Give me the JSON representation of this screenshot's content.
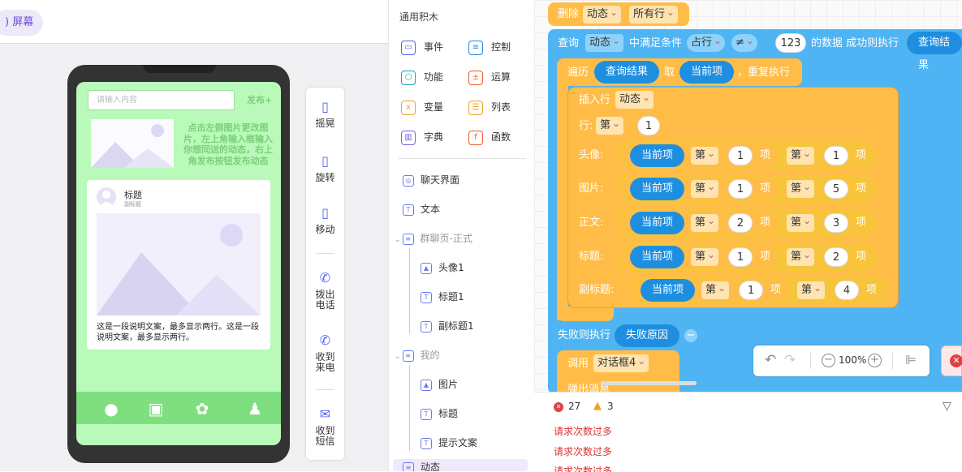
{
  "topbar": {
    "screen_label": ") 屏幕"
  },
  "phone": {
    "search_placeholder": "请输入内容",
    "post_label": "发布+",
    "tip_text": "点击左侧图片更改图片，左上角输入框输入你想同送的动态，右上角发布按钮发布动态",
    "card_title": "标题",
    "card_subtitle": "副标题",
    "card_desc": "这是一段说明文案，最多显示两行。这是一段说明文案，最多显示两行。",
    "tabs": [
      "wechat-icon",
      "contacts-icon",
      "discover-icon",
      "me-icon"
    ]
  },
  "tools": [
    {
      "label": "摇晃",
      "icon": "phone-shake-icon"
    },
    {
      "label": "旋转",
      "icon": "rotate-icon"
    },
    {
      "label": "移动",
      "icon": "move-icon"
    },
    {
      "label": "拨出\n电话",
      "icon": "call-out-icon"
    },
    {
      "label": "收到\n来电",
      "icon": "call-in-icon"
    },
    {
      "label": "收到\n短信",
      "icon": "sms-icon"
    }
  ],
  "blocks_panel": {
    "header": "通用积木",
    "categories": [
      {
        "label": "事件",
        "icon": "event-icon",
        "color": "#4b63f5"
      },
      {
        "label": "控制",
        "icon": "control-icon",
        "color": "#1e88e5"
      },
      {
        "label": "功能",
        "icon": "function-icon",
        "color": "#12a8b8"
      },
      {
        "label": "运算",
        "icon": "operator-icon",
        "color": "#f05a28"
      },
      {
        "label": "变量",
        "icon": "variable-icon",
        "color": "#f0a020"
      },
      {
        "label": "列表",
        "icon": "list-icon",
        "color": "#f0a020"
      },
      {
        "label": "字典",
        "icon": "dict-icon",
        "color": "#7b5cf0"
      },
      {
        "label": "函数",
        "icon": "func-icon",
        "color": "#f05a28"
      }
    ],
    "tree": [
      {
        "label": "聊天界面",
        "type": "page"
      },
      {
        "label": "文本",
        "type": "text"
      },
      {
        "label": "群聊页-正式",
        "type": "group"
      },
      {
        "label": "头像1",
        "type": "image"
      },
      {
        "label": "标题1",
        "type": "text"
      },
      {
        "label": "副标题1",
        "type": "text"
      },
      {
        "label": "我的",
        "type": "group"
      },
      {
        "label": "图片",
        "type": "image"
      },
      {
        "label": "标题",
        "type": "text"
      },
      {
        "label": "提示文案",
        "type": "text"
      },
      {
        "label": "动态",
        "type": "group"
      }
    ]
  },
  "code": {
    "delete": {
      "kw": "删除",
      "table": "动态",
      "which": "所有行"
    },
    "query": {
      "kw": "查询",
      "table": "动态",
      "cond_kw": "中满足条件",
      "field": "占行",
      "op": "≠",
      "value": "123",
      "tail": "的数据 成功则执行",
      "result": "查询结果"
    },
    "loop": {
      "kw": "遍历",
      "src": "查询结果",
      "take": "取",
      "item": "当前项",
      "tail": "，重复执行"
    },
    "insert": {
      "kw": "插入行",
      "table": "动态",
      "row_label": "行:",
      "row_sel": "第",
      "row_num": "1"
    },
    "rows": [
      {
        "label": "头像:",
        "a": "1",
        "b": "1"
      },
      {
        "label": "图片:",
        "a": "1",
        "b": "5"
      },
      {
        "label": "正文:",
        "a": "2",
        "b": "3"
      },
      {
        "label": "标题:",
        "a": "1",
        "b": "2"
      },
      {
        "label": "副标题:",
        "a": "1",
        "b": "4"
      }
    ],
    "item_label": "当前项",
    "nth": "第",
    "xiang": "项",
    "fail": {
      "kw": "失败则执行",
      "reason": "失败原因"
    },
    "call": {
      "kw": "调用",
      "target": "对话框4",
      "next": "弹出消息"
    }
  },
  "zoom": {
    "level": "100%"
  },
  "errors": {
    "error_count": "27",
    "warn_count": "3",
    "messages": [
      "请求次数过多",
      "请求次数过多",
      "请求次数过多"
    ]
  }
}
